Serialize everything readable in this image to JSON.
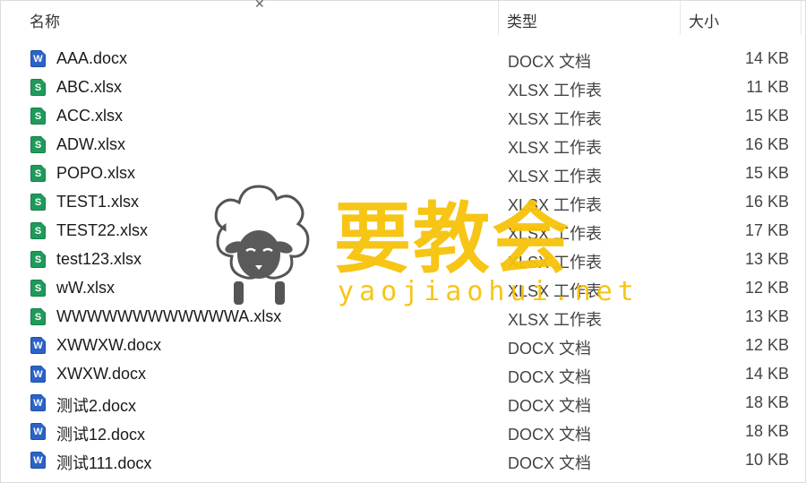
{
  "columns": {
    "name": "名称",
    "type": "类型",
    "size": "大小"
  },
  "files": [
    {
      "name": "AAA.docx",
      "type": "DOCX 文档",
      "size": "14 KB",
      "icon": "word-doc-icon",
      "glyph": "W"
    },
    {
      "name": "ABC.xlsx",
      "type": "XLSX 工作表",
      "size": "11 KB",
      "icon": "spreadsheet-icon",
      "glyph": "S"
    },
    {
      "name": "ACC.xlsx",
      "type": "XLSX 工作表",
      "size": "15 KB",
      "icon": "spreadsheet-icon",
      "glyph": "S"
    },
    {
      "name": "ADW.xlsx",
      "type": "XLSX 工作表",
      "size": "16 KB",
      "icon": "spreadsheet-icon",
      "glyph": "S"
    },
    {
      "name": "POPO.xlsx",
      "type": "XLSX 工作表",
      "size": "15 KB",
      "icon": "spreadsheet-icon",
      "glyph": "S"
    },
    {
      "name": "TEST1.xlsx",
      "type": "XLSX 工作表",
      "size": "16 KB",
      "icon": "spreadsheet-icon",
      "glyph": "S"
    },
    {
      "name": "TEST22.xlsx",
      "type": "XLSX 工作表",
      "size": "17 KB",
      "icon": "spreadsheet-icon",
      "glyph": "S"
    },
    {
      "name": "test123.xlsx",
      "type": "XLSX 工作表",
      "size": "13 KB",
      "icon": "spreadsheet-icon",
      "glyph": "S"
    },
    {
      "name": "wW.xlsx",
      "type": "XLSX 工作表",
      "size": "12 KB",
      "icon": "spreadsheet-icon",
      "glyph": "S"
    },
    {
      "name": "WWWWWWWWWWWWA.xlsx",
      "type": "XLSX 工作表",
      "size": "13 KB",
      "icon": "spreadsheet-icon",
      "glyph": "S"
    },
    {
      "name": "XWWXW.docx",
      "type": "DOCX 文档",
      "size": "12 KB",
      "icon": "word-doc-icon",
      "glyph": "W"
    },
    {
      "name": "XWXW.docx",
      "type": "DOCX 文档",
      "size": "14 KB",
      "icon": "word-doc-icon",
      "glyph": "W"
    },
    {
      "name": "测试2.docx",
      "type": "DOCX 文档",
      "size": "18 KB",
      "icon": "word-doc-icon",
      "glyph": "W"
    },
    {
      "name": "测试12.docx",
      "type": "DOCX 文档",
      "size": "18 KB",
      "icon": "word-doc-icon",
      "glyph": "W"
    },
    {
      "name": "测试111.docx",
      "type": "DOCX 文档",
      "size": "10 KB",
      "icon": "word-doc-icon",
      "glyph": "W"
    }
  ],
  "watermark": {
    "title": "要教会",
    "url": "yaojiaohui.net"
  },
  "colors": {
    "word": "#2b63c7",
    "xlsx": "#1f9a5b",
    "watermark": "#f7c20a"
  }
}
